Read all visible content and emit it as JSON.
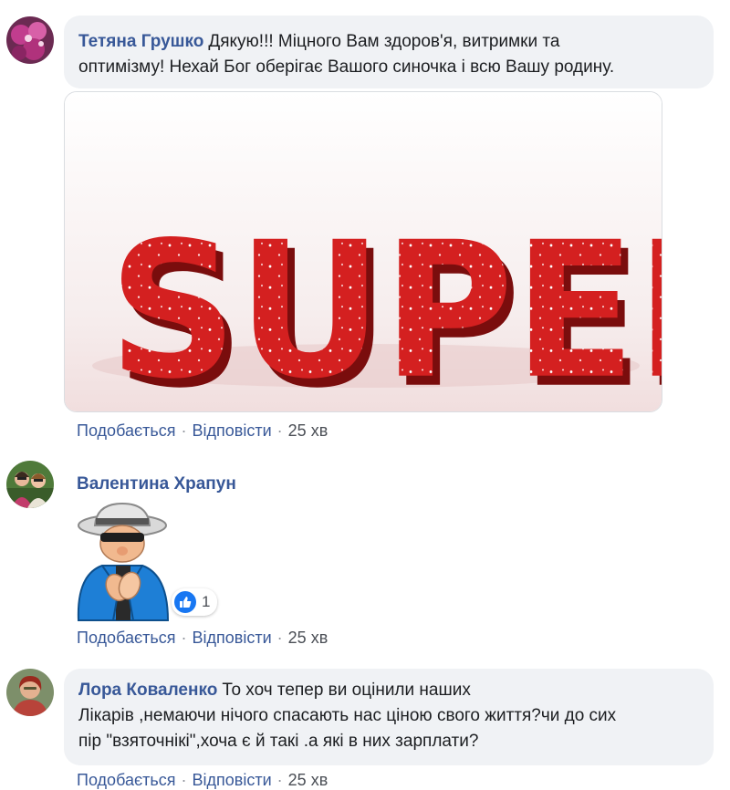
{
  "comments": [
    {
      "author": "Тетяна Грушко",
      "text_line1": "Дякую!!! Міцного Вам здоров'я, витримки та",
      "text_line2": "оптимізму! Нехай Бог оберігає Вашого синочка і всю Вашу родину.",
      "sticker_text": "SUPER",
      "like_label": "Подобається",
      "reply_label": "Відповісти",
      "time": "25 хв"
    },
    {
      "author": "Валентина Храпун",
      "reaction_count": "1",
      "like_label": "Подобається",
      "reply_label": "Відповісти",
      "time": "25 хв"
    },
    {
      "author": "Лора Коваленко",
      "text_line1": "То хоч тепер ви оцінили наших",
      "text_line2": "Лікарів ,немаючи нічого спасають нас ціною свого життя?чи до сих",
      "text_line3": "пір \"взяточнікі\",хоча є й такі .а які в них зарплати?",
      "like_label": "Подобається",
      "reply_label": "Відповісти",
      "time": "25 хв"
    }
  ],
  "separator": "·",
  "colors": {
    "link": "#385898",
    "bubble": "#f0f2f5",
    "like_blue": "#1877f2"
  },
  "icons": [
    "avatar-orchid",
    "avatar-two-women",
    "avatar-woman",
    "thumbs-up-icon"
  ]
}
